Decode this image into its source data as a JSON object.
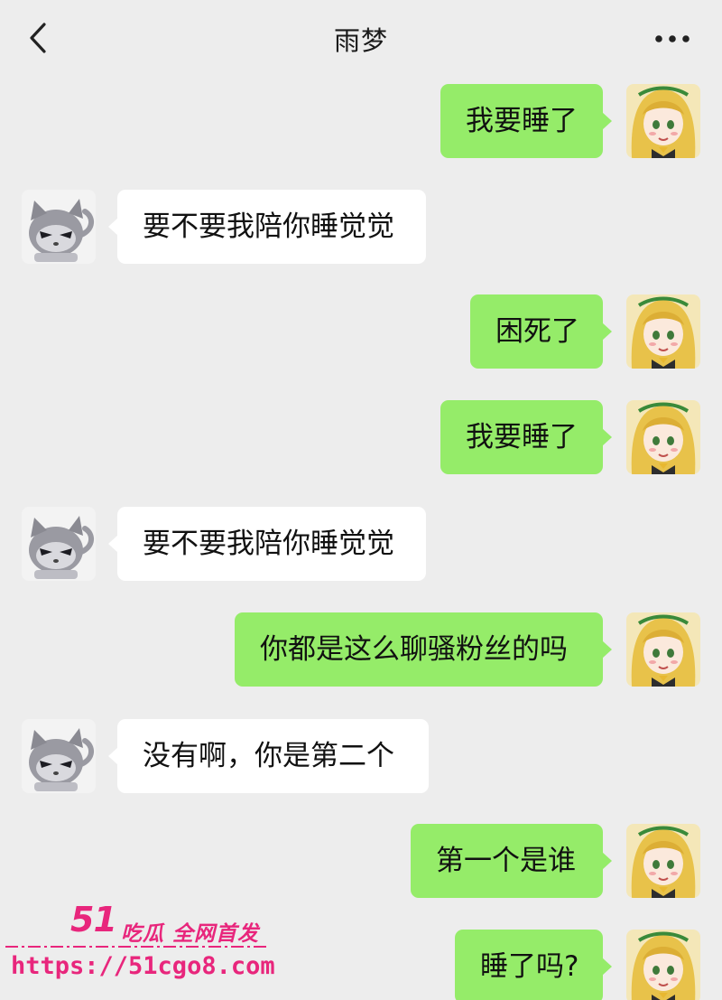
{
  "header": {
    "title": "雨梦",
    "back_icon": "chevron-left-icon",
    "more_icon": "more-dots-icon"
  },
  "colors": {
    "background": "#ededed",
    "sent_bubble": "#95ec69",
    "received_bubble": "#ffffff",
    "watermark": "#e8267c"
  },
  "messages": [
    {
      "side": "me",
      "text": "我要睡了"
    },
    {
      "side": "peer",
      "text": "要不要我陪你睡觉觉"
    },
    {
      "side": "me",
      "text": "困死了"
    },
    {
      "side": "me",
      "text": "我要睡了"
    },
    {
      "side": "peer",
      "text": "要不要我陪你睡觉觉"
    },
    {
      "side": "me",
      "text": "你都是这么聊骚粉丝的吗"
    },
    {
      "side": "peer",
      "text": "没有啊，你是第二个"
    },
    {
      "side": "me",
      "text": "第一个是谁"
    },
    {
      "side": "me",
      "text": "睡了吗?"
    }
  ],
  "watermark": {
    "logo": "51",
    "slogan": "吃瓜 全网首发",
    "url": "https://51cgo8.com"
  }
}
